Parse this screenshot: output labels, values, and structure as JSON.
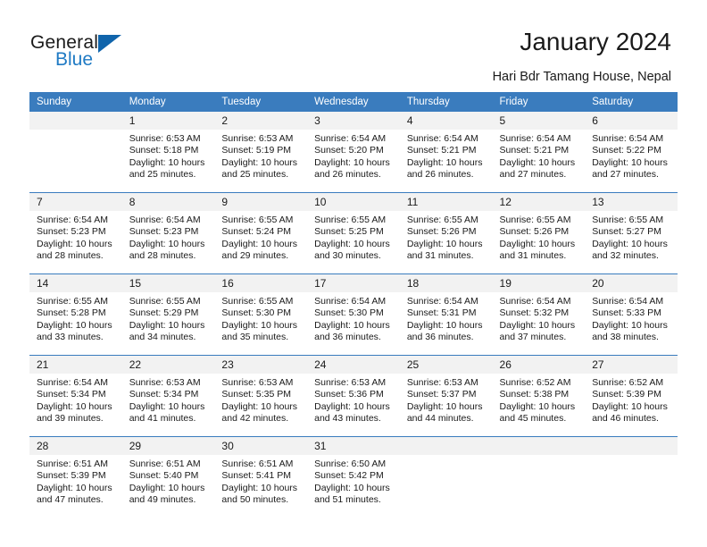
{
  "brand": {
    "name_part1": "General",
    "name_part2": "Blue"
  },
  "header": {
    "title": "January 2024",
    "subtitle": "Hari Bdr Tamang House, Nepal"
  },
  "colors": {
    "header_blue": "#3a7cbe",
    "logo_blue": "#1f7ac4",
    "daynum_bg": "#f2f2f2"
  },
  "weekdays": [
    "Sunday",
    "Monday",
    "Tuesday",
    "Wednesday",
    "Thursday",
    "Friday",
    "Saturday"
  ],
  "weeks": [
    [
      {
        "day": "",
        "sunrise": "",
        "sunset": "",
        "daylight1": "",
        "daylight2": "",
        "blank": true
      },
      {
        "day": "1",
        "sunrise": "Sunrise: 6:53 AM",
        "sunset": "Sunset: 5:18 PM",
        "daylight1": "Daylight: 10 hours",
        "daylight2": "and 25 minutes."
      },
      {
        "day": "2",
        "sunrise": "Sunrise: 6:53 AM",
        "sunset": "Sunset: 5:19 PM",
        "daylight1": "Daylight: 10 hours",
        "daylight2": "and 25 minutes."
      },
      {
        "day": "3",
        "sunrise": "Sunrise: 6:54 AM",
        "sunset": "Sunset: 5:20 PM",
        "daylight1": "Daylight: 10 hours",
        "daylight2": "and 26 minutes."
      },
      {
        "day": "4",
        "sunrise": "Sunrise: 6:54 AM",
        "sunset": "Sunset: 5:21 PM",
        "daylight1": "Daylight: 10 hours",
        "daylight2": "and 26 minutes."
      },
      {
        "day": "5",
        "sunrise": "Sunrise: 6:54 AM",
        "sunset": "Sunset: 5:21 PM",
        "daylight1": "Daylight: 10 hours",
        "daylight2": "and 27 minutes."
      },
      {
        "day": "6",
        "sunrise": "Sunrise: 6:54 AM",
        "sunset": "Sunset: 5:22 PM",
        "daylight1": "Daylight: 10 hours",
        "daylight2": "and 27 minutes."
      }
    ],
    [
      {
        "day": "7",
        "sunrise": "Sunrise: 6:54 AM",
        "sunset": "Sunset: 5:23 PM",
        "daylight1": "Daylight: 10 hours",
        "daylight2": "and 28 minutes."
      },
      {
        "day": "8",
        "sunrise": "Sunrise: 6:54 AM",
        "sunset": "Sunset: 5:23 PM",
        "daylight1": "Daylight: 10 hours",
        "daylight2": "and 28 minutes."
      },
      {
        "day": "9",
        "sunrise": "Sunrise: 6:55 AM",
        "sunset": "Sunset: 5:24 PM",
        "daylight1": "Daylight: 10 hours",
        "daylight2": "and 29 minutes."
      },
      {
        "day": "10",
        "sunrise": "Sunrise: 6:55 AM",
        "sunset": "Sunset: 5:25 PM",
        "daylight1": "Daylight: 10 hours",
        "daylight2": "and 30 minutes."
      },
      {
        "day": "11",
        "sunrise": "Sunrise: 6:55 AM",
        "sunset": "Sunset: 5:26 PM",
        "daylight1": "Daylight: 10 hours",
        "daylight2": "and 31 minutes."
      },
      {
        "day": "12",
        "sunrise": "Sunrise: 6:55 AM",
        "sunset": "Sunset: 5:26 PM",
        "daylight1": "Daylight: 10 hours",
        "daylight2": "and 31 minutes."
      },
      {
        "day": "13",
        "sunrise": "Sunrise: 6:55 AM",
        "sunset": "Sunset: 5:27 PM",
        "daylight1": "Daylight: 10 hours",
        "daylight2": "and 32 minutes."
      }
    ],
    [
      {
        "day": "14",
        "sunrise": "Sunrise: 6:55 AM",
        "sunset": "Sunset: 5:28 PM",
        "daylight1": "Daylight: 10 hours",
        "daylight2": "and 33 minutes."
      },
      {
        "day": "15",
        "sunrise": "Sunrise: 6:55 AM",
        "sunset": "Sunset: 5:29 PM",
        "daylight1": "Daylight: 10 hours",
        "daylight2": "and 34 minutes."
      },
      {
        "day": "16",
        "sunrise": "Sunrise: 6:55 AM",
        "sunset": "Sunset: 5:30 PM",
        "daylight1": "Daylight: 10 hours",
        "daylight2": "and 35 minutes."
      },
      {
        "day": "17",
        "sunrise": "Sunrise: 6:54 AM",
        "sunset": "Sunset: 5:30 PM",
        "daylight1": "Daylight: 10 hours",
        "daylight2": "and 36 minutes."
      },
      {
        "day": "18",
        "sunrise": "Sunrise: 6:54 AM",
        "sunset": "Sunset: 5:31 PM",
        "daylight1": "Daylight: 10 hours",
        "daylight2": "and 36 minutes."
      },
      {
        "day": "19",
        "sunrise": "Sunrise: 6:54 AM",
        "sunset": "Sunset: 5:32 PM",
        "daylight1": "Daylight: 10 hours",
        "daylight2": "and 37 minutes."
      },
      {
        "day": "20",
        "sunrise": "Sunrise: 6:54 AM",
        "sunset": "Sunset: 5:33 PM",
        "daylight1": "Daylight: 10 hours",
        "daylight2": "and 38 minutes."
      }
    ],
    [
      {
        "day": "21",
        "sunrise": "Sunrise: 6:54 AM",
        "sunset": "Sunset: 5:34 PM",
        "daylight1": "Daylight: 10 hours",
        "daylight2": "and 39 minutes."
      },
      {
        "day": "22",
        "sunrise": "Sunrise: 6:53 AM",
        "sunset": "Sunset: 5:34 PM",
        "daylight1": "Daylight: 10 hours",
        "daylight2": "and 41 minutes."
      },
      {
        "day": "23",
        "sunrise": "Sunrise: 6:53 AM",
        "sunset": "Sunset: 5:35 PM",
        "daylight1": "Daylight: 10 hours",
        "daylight2": "and 42 minutes."
      },
      {
        "day": "24",
        "sunrise": "Sunrise: 6:53 AM",
        "sunset": "Sunset: 5:36 PM",
        "daylight1": "Daylight: 10 hours",
        "daylight2": "and 43 minutes."
      },
      {
        "day": "25",
        "sunrise": "Sunrise: 6:53 AM",
        "sunset": "Sunset: 5:37 PM",
        "daylight1": "Daylight: 10 hours",
        "daylight2": "and 44 minutes."
      },
      {
        "day": "26",
        "sunrise": "Sunrise: 6:52 AM",
        "sunset": "Sunset: 5:38 PM",
        "daylight1": "Daylight: 10 hours",
        "daylight2": "and 45 minutes."
      },
      {
        "day": "27",
        "sunrise": "Sunrise: 6:52 AM",
        "sunset": "Sunset: 5:39 PM",
        "daylight1": "Daylight: 10 hours",
        "daylight2": "and 46 minutes."
      }
    ],
    [
      {
        "day": "28",
        "sunrise": "Sunrise: 6:51 AM",
        "sunset": "Sunset: 5:39 PM",
        "daylight1": "Daylight: 10 hours",
        "daylight2": "and 47 minutes."
      },
      {
        "day": "29",
        "sunrise": "Sunrise: 6:51 AM",
        "sunset": "Sunset: 5:40 PM",
        "daylight1": "Daylight: 10 hours",
        "daylight2": "and 49 minutes."
      },
      {
        "day": "30",
        "sunrise": "Sunrise: 6:51 AM",
        "sunset": "Sunset: 5:41 PM",
        "daylight1": "Daylight: 10 hours",
        "daylight2": "and 50 minutes."
      },
      {
        "day": "31",
        "sunrise": "Sunrise: 6:50 AM",
        "sunset": "Sunset: 5:42 PM",
        "daylight1": "Daylight: 10 hours",
        "daylight2": "and 51 minutes."
      },
      {
        "day": "",
        "sunrise": "",
        "sunset": "",
        "daylight1": "",
        "daylight2": "",
        "blank": true
      },
      {
        "day": "",
        "sunrise": "",
        "sunset": "",
        "daylight1": "",
        "daylight2": "",
        "blank": true
      },
      {
        "day": "",
        "sunrise": "",
        "sunset": "",
        "daylight1": "",
        "daylight2": "",
        "blank": true
      }
    ]
  ]
}
